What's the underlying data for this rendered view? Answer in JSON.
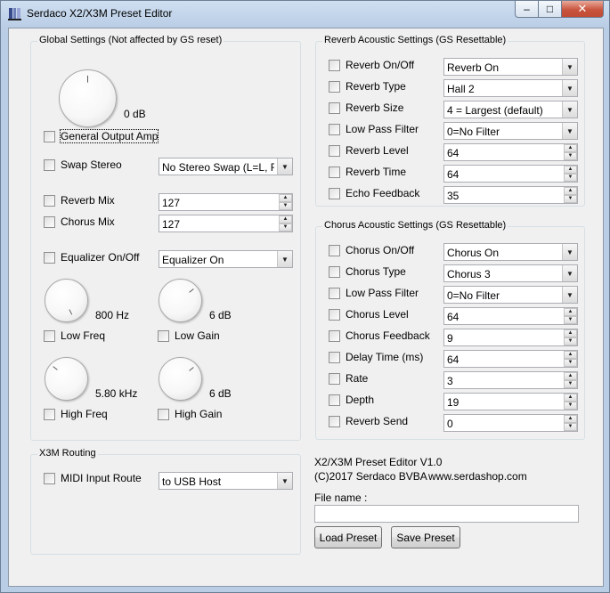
{
  "window": {
    "title": "Serdaco X2/X3M Preset Editor",
    "min_glyph": "–",
    "max_glyph": "□",
    "close_glyph": "✕"
  },
  "global": {
    "title": "Global Settings (Not affected by GS reset)",
    "master_knob_value": "0 dB",
    "general_output_amp": "General Output Amp",
    "swap_stereo": "Swap Stereo",
    "swap_stereo_value": "No Stereo Swap (L=L, R=R",
    "reverb_mix": "Reverb Mix",
    "reverb_mix_value": "127",
    "chorus_mix": "Chorus Mix",
    "chorus_mix_value": "127",
    "equalizer": "Equalizer On/Off",
    "equalizer_value": "Equalizer On",
    "low_freq_knob_value": "800 Hz",
    "low_gain_knob_value": "6 dB",
    "low_freq": "Low Freq",
    "low_gain": "Low Gain",
    "high_freq_knob_value": "5.80 kHz",
    "high_gain_knob_value": "6 dB",
    "high_freq": "High Freq",
    "high_gain": "High Gain"
  },
  "routing": {
    "title": "X3M Routing",
    "midi_input_route": "MIDI Input Route",
    "midi_input_route_value": "to USB Host"
  },
  "reverb": {
    "title": "Reverb Acoustic Settings (GS Resettable)",
    "rows": [
      {
        "label": "Reverb On/Off",
        "value": "Reverb On",
        "kind": "combo"
      },
      {
        "label": "Reverb Type",
        "value": "Hall 2",
        "kind": "combo"
      },
      {
        "label": "Reverb Size",
        "value": "4 = Largest (default)",
        "kind": "combo"
      },
      {
        "label": "Low Pass Filter",
        "value": "0=No Filter",
        "kind": "combo"
      },
      {
        "label": "Reverb Level",
        "value": "64",
        "kind": "spin"
      },
      {
        "label": "Reverb Time",
        "value": "64",
        "kind": "spin"
      },
      {
        "label": "Echo Feedback",
        "value": "35",
        "kind": "spin"
      }
    ]
  },
  "chorus": {
    "title": "Chorus Acoustic Settings (GS Resettable)",
    "rows": [
      {
        "label": "Chorus On/Off",
        "value": "Chorus On",
        "kind": "combo"
      },
      {
        "label": "Chorus Type",
        "value": "Chorus 3",
        "kind": "combo"
      },
      {
        "label": "Low Pass Filter",
        "value": "0=No Filter",
        "kind": "combo"
      },
      {
        "label": "Chorus Level",
        "value": "64",
        "kind": "spin"
      },
      {
        "label": "Chorus Feedback",
        "value": "9",
        "kind": "spin"
      },
      {
        "label": "Delay Time (ms)",
        "value": "64",
        "kind": "spin"
      },
      {
        "label": "Rate",
        "value": "3",
        "kind": "spin"
      },
      {
        "label": "Depth",
        "value": "19",
        "kind": "spin"
      },
      {
        "label": "Reverb Send",
        "value": "0",
        "kind": "spin"
      }
    ]
  },
  "about": {
    "version": "X2/X3M Preset Editor V1.0",
    "copyright": "(C)2017 Serdaco BVBA",
    "website": "www.serdashop.com"
  },
  "file": {
    "label": "File name :",
    "value": "",
    "load_button": "Load Preset",
    "save_button": "Save Preset"
  },
  "glyphs": {
    "combo_arrow": "▼",
    "spin_up": "▲",
    "spin_down": "▼"
  }
}
